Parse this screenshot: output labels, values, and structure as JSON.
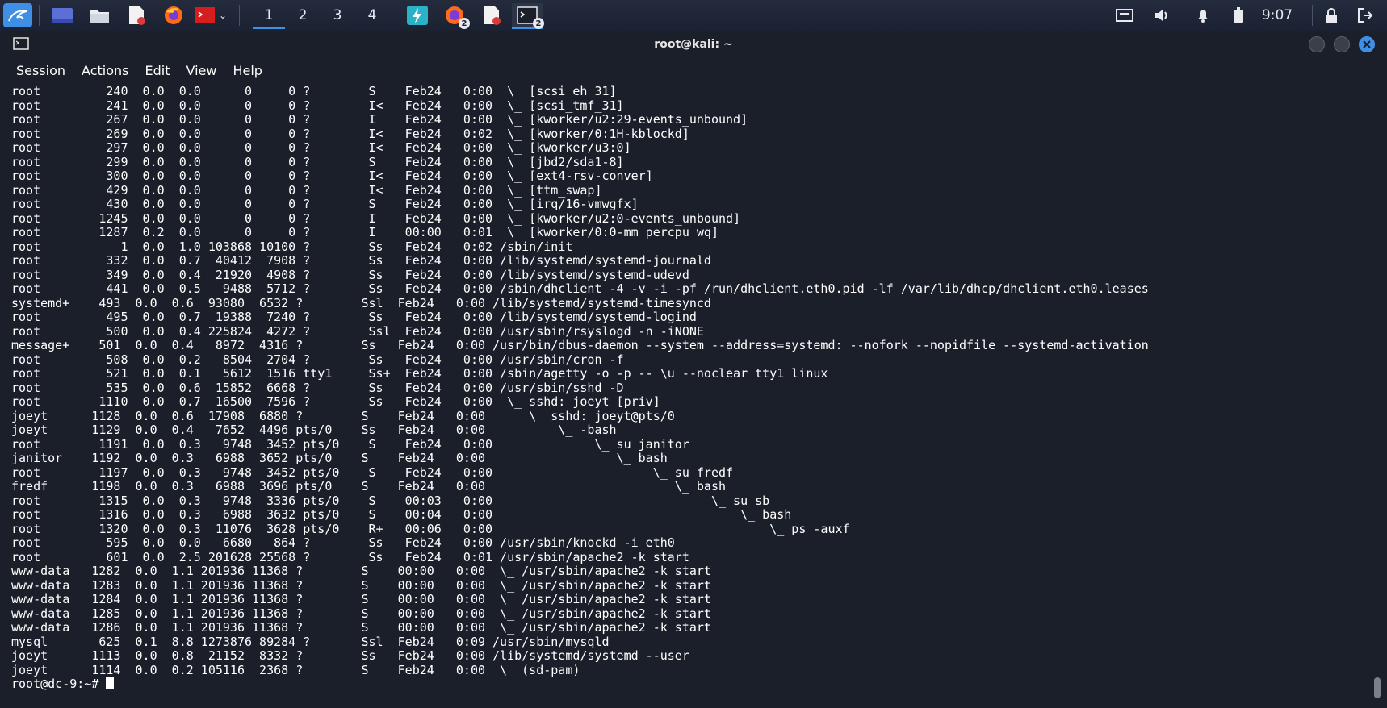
{
  "taskbar": {
    "workspaces": [
      "1",
      "2",
      "3",
      "4"
    ],
    "active_workspace": "1",
    "badges": [
      "2",
      "2"
    ],
    "clock": "9:07",
    "accent": "#3f8fe4"
  },
  "window": {
    "title": "root@kali: ~",
    "menu": [
      "Session",
      "Actions",
      "Edit",
      "View",
      "Help"
    ]
  },
  "terminal": {
    "lines": [
      "root         240  0.0  0.0      0     0 ?        S    Feb24   0:00  \\_ [scsi_eh_31]",
      "root         241  0.0  0.0      0     0 ?        I<   Feb24   0:00  \\_ [scsi_tmf_31]",
      "root         267  0.0  0.0      0     0 ?        I    Feb24   0:00  \\_ [kworker/u2:29-events_unbound]",
      "root         269  0.0  0.0      0     0 ?        I<   Feb24   0:02  \\_ [kworker/0:1H-kblockd]",
      "root         297  0.0  0.0      0     0 ?        I<   Feb24   0:00  \\_ [kworker/u3:0]",
      "root         299  0.0  0.0      0     0 ?        S    Feb24   0:00  \\_ [jbd2/sda1-8]",
      "root         300  0.0  0.0      0     0 ?        I<   Feb24   0:00  \\_ [ext4-rsv-conver]",
      "root         429  0.0  0.0      0     0 ?        I<   Feb24   0:00  \\_ [ttm_swap]",
      "root         430  0.0  0.0      0     0 ?        S    Feb24   0:00  \\_ [irq/16-vmwgfx]",
      "root        1245  0.0  0.0      0     0 ?        I    Feb24   0:00  \\_ [kworker/u2:0-events_unbound]",
      "root        1287  0.2  0.0      0     0 ?        I    00:00   0:01  \\_ [kworker/0:0-mm_percpu_wq]",
      "root           1  0.0  1.0 103868 10100 ?        Ss   Feb24   0:02 /sbin/init",
      "root         332  0.0  0.7  40412  7908 ?        Ss   Feb24   0:00 /lib/systemd/systemd-journald",
      "root         349  0.0  0.4  21920  4908 ?        Ss   Feb24   0:00 /lib/systemd/systemd-udevd",
      "root         441  0.0  0.5   9488  5712 ?        Ss   Feb24   0:00 /sbin/dhclient -4 -v -i -pf /run/dhclient.eth0.pid -lf /var/lib/dhcp/dhclient.eth0.leases",
      "systemd+    493  0.0  0.6  93080  6532 ?        Ssl  Feb24   0:00 /lib/systemd/systemd-timesyncd",
      "root         495  0.0  0.7  19388  7240 ?        Ss   Feb24   0:00 /lib/systemd/systemd-logind",
      "root         500  0.0  0.4 225824  4272 ?        Ssl  Feb24   0:00 /usr/sbin/rsyslogd -n -iNONE",
      "message+    501  0.0  0.4   8972  4316 ?        Ss   Feb24   0:00 /usr/bin/dbus-daemon --system --address=systemd: --nofork --nopidfile --systemd-activation",
      "root         508  0.0  0.2   8504  2704 ?        Ss   Feb24   0:00 /usr/sbin/cron -f",
      "root         521  0.0  0.1   5612  1516 tty1     Ss+  Feb24   0:00 /sbin/agetty -o -p -- \\u --noclear tty1 linux",
      "root         535  0.0  0.6  15852  6668 ?        Ss   Feb24   0:00 /usr/sbin/sshd -D",
      "root        1110  0.0  0.7  16500  7596 ?        Ss   Feb24   0:00  \\_ sshd: joeyt [priv]",
      "joeyt      1128  0.0  0.6  17908  6880 ?        S    Feb24   0:00      \\_ sshd: joeyt@pts/0",
      "joeyt      1129  0.0  0.4   7652  4496 pts/0    Ss   Feb24   0:00          \\_ -bash",
      "root        1191  0.0  0.3   9748  3452 pts/0    S    Feb24   0:00              \\_ su janitor",
      "janitor    1192  0.0  0.3   6988  3652 pts/0    S    Feb24   0:00                  \\_ bash",
      "root        1197  0.0  0.3   9748  3452 pts/0    S    Feb24   0:00                      \\_ su fredf",
      "fredf      1198  0.0  0.3   6988  3696 pts/0    S    Feb24   0:00                          \\_ bash",
      "root        1315  0.0  0.3   9748  3336 pts/0    S    00:03   0:00                              \\_ su sb",
      "root        1316  0.0  0.3   6988  3632 pts/0    S    00:04   0:00                                  \\_ bash",
      "root        1320  0.0  0.3  11076  3628 pts/0    R+   00:06   0:00                                      \\_ ps -auxf",
      "root         595  0.0  0.0   6680   864 ?        Ss   Feb24   0:00 /usr/sbin/knockd -i eth0",
      "root         601  0.0  2.5 201628 25568 ?        Ss   Feb24   0:01 /usr/sbin/apache2 -k start",
      "www-data   1282  0.0  1.1 201936 11368 ?        S    00:00   0:00  \\_ /usr/sbin/apache2 -k start",
      "www-data   1283  0.0  1.1 201936 11368 ?        S    00:00   0:00  \\_ /usr/sbin/apache2 -k start",
      "www-data   1284  0.0  1.1 201936 11368 ?        S    00:00   0:00  \\_ /usr/sbin/apache2 -k start",
      "www-data   1285  0.0  1.1 201936 11368 ?        S    00:00   0:00  \\_ /usr/sbin/apache2 -k start",
      "www-data   1286  0.0  1.1 201936 11368 ?        S    00:00   0:00  \\_ /usr/sbin/apache2 -k start",
      "mysql       625  0.1  8.8 1273876 89284 ?       Ssl  Feb24   0:09 /usr/sbin/mysqld",
      "joeyt      1113  0.0  0.8  21152  8332 ?        Ss   Feb24   0:00 /lib/systemd/systemd --user",
      "joeyt      1114  0.0  0.2 105116  2368 ?        S    Feb24   0:00  \\_ (sd-pam)"
    ],
    "prompt": "root@dc-9:~# "
  }
}
